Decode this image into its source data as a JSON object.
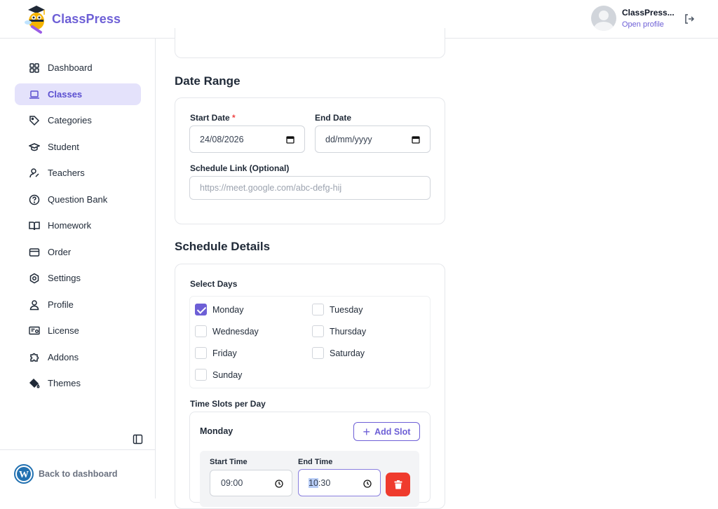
{
  "app": {
    "name": "ClassPress"
  },
  "user": {
    "name": "ClassPress...",
    "link": "Open profile"
  },
  "sidebar": {
    "items": [
      {
        "label": "Dashboard",
        "icon": "grid-icon",
        "active": false
      },
      {
        "label": "Classes",
        "icon": "laptop-icon",
        "active": true
      },
      {
        "label": "Categories",
        "icon": "tag-icon",
        "active": false
      },
      {
        "label": "Student",
        "icon": "graduation-cap-icon",
        "active": false
      },
      {
        "label": "Teachers",
        "icon": "teacher-icon",
        "active": false
      },
      {
        "label": "Question Bank",
        "icon": "question-circle-icon",
        "active": false
      },
      {
        "label": "Homework",
        "icon": "book-open-icon",
        "active": false
      },
      {
        "label": "Order",
        "icon": "credit-card-icon",
        "active": false
      },
      {
        "label": "Settings",
        "icon": "gear-icon",
        "active": false
      },
      {
        "label": "Profile",
        "icon": "user-icon",
        "active": false
      },
      {
        "label": "License",
        "icon": "certificate-icon",
        "active": false
      },
      {
        "label": "Addons",
        "icon": "puzzle-icon",
        "active": false
      },
      {
        "label": "Themes",
        "icon": "paint-bucket-icon",
        "active": false
      }
    ],
    "back_label": "Back to dashboard"
  },
  "date_range": {
    "title": "Date Range",
    "start_label": "Start Date",
    "required_mark": "*",
    "start_value": "24/08/2026",
    "end_label": "End Date",
    "end_placeholder": "dd/mm/yyyy",
    "link_label": "Schedule Link (Optional)",
    "link_placeholder": "https://meet.google.com/abc-defg-hij"
  },
  "schedule": {
    "title": "Schedule Details",
    "select_days_label": "Select Days",
    "days": [
      {
        "label": "Monday",
        "checked": true
      },
      {
        "label": "Tuesday",
        "checked": false
      },
      {
        "label": "Wednesday",
        "checked": false
      },
      {
        "label": "Thursday",
        "checked": false
      },
      {
        "label": "Friday",
        "checked": false
      },
      {
        "label": "Saturday",
        "checked": false
      },
      {
        "label": "Sunday",
        "checked": false
      }
    ],
    "slots_label": "Time Slots per Day",
    "slot_day": "Monday",
    "add_slot_label": "Add Slot",
    "start_time_label": "Start Time",
    "start_time_value": "09:00",
    "end_time_label": "End Time",
    "end_time_hour": "10",
    "end_time_rest": ":30"
  },
  "colors": {
    "accent": "#6d5fd6",
    "active_bg": "#e4e2fb",
    "danger": "#ef3b2d"
  }
}
